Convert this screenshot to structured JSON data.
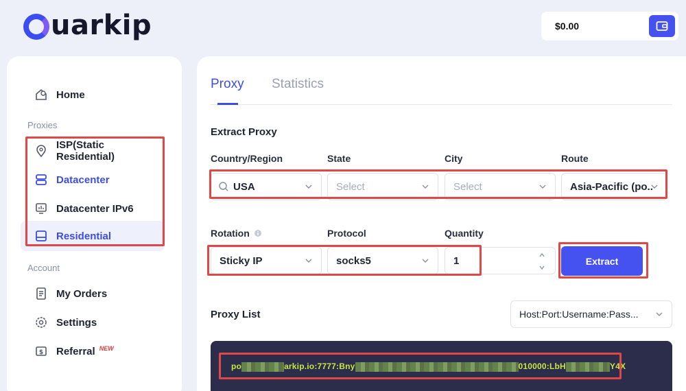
{
  "brand": {
    "logo_text": "uarkip"
  },
  "wallet": {
    "balance": "$0.00"
  },
  "sidebar": {
    "home": "Home",
    "proxies_label": "Proxies",
    "items": [
      {
        "label": "ISP(Static Residential)"
      },
      {
        "label": "Datacenter"
      },
      {
        "label": "Datacenter IPv6"
      },
      {
        "label": "Residential"
      }
    ],
    "account_label": "Account",
    "my_orders": "My Orders",
    "settings": "Settings",
    "referral": "Referral",
    "referral_badge": "NEW"
  },
  "tabs": {
    "proxy": "Proxy",
    "statistics": "Statistics"
  },
  "extract": {
    "title": "Extract Proxy",
    "country_label": "Country/Region",
    "country_value": "USA",
    "state_label": "State",
    "state_placeholder": "Select",
    "city_label": "City",
    "city_placeholder": "Select",
    "route_label": "Route",
    "route_value": "Asia-Pacific (po...",
    "rotation_label": "Rotation",
    "rotation_value": "Sticky IP",
    "protocol_label": "Protocol",
    "protocol_value": "socks5",
    "quantity_label": "Quantity",
    "quantity_value": "1",
    "extract_button": "Extract"
  },
  "proxy_list": {
    "title": "Proxy List",
    "format_value": "Host:Port:Username:Pass...",
    "line_prefix": "po",
    "line_part2": "arkip.io:7777:Bny",
    "line_part3": "010000:LbH",
    "line_part4": "Y4X"
  },
  "colors": {
    "accent": "#4552ef",
    "highlight": "#e04848",
    "proxy_bg": "#2b2d4a",
    "proxy_text": "#c9e63f"
  }
}
